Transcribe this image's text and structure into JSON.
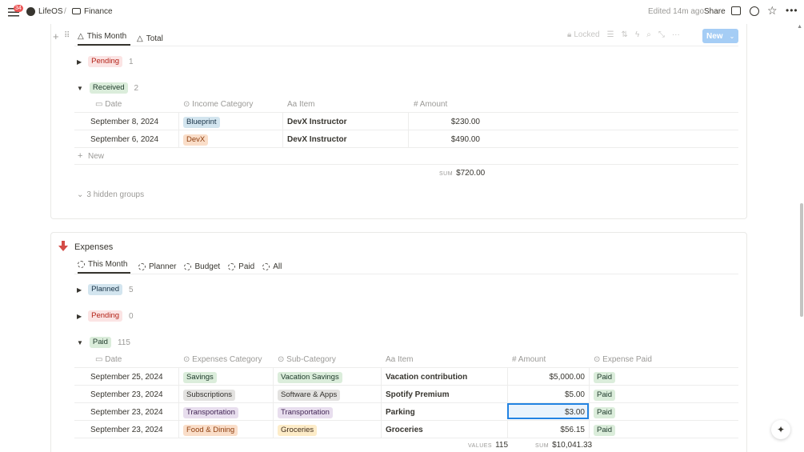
{
  "topbar": {
    "notif_count": "34",
    "crumb1": "LifeOS",
    "sep": "/",
    "crumb2": "Finance",
    "edited": "Edited 14m ago",
    "share": "Share"
  },
  "income": {
    "tabs": [
      "This Month",
      "Total"
    ],
    "toolbar": {
      "locked": "Locked",
      "new": "New"
    },
    "groups": [
      {
        "label": "Pending",
        "count": "1",
        "color": "red"
      },
      {
        "label": "Received",
        "count": "2",
        "color": "green"
      }
    ],
    "columns": [
      "Date",
      "Income Category",
      "Item",
      "Amount"
    ],
    "rows": [
      {
        "date": "September 8, 2024",
        "category": "Blueprint",
        "item": "DevX Instructor",
        "amount": "$230.00"
      },
      {
        "date": "September 6, 2024",
        "category": "DevX",
        "item": "DevX Instructor",
        "amount": "$490.00"
      }
    ],
    "new_row": "New",
    "sum_label": "SUM",
    "sum_value": "$720.00",
    "hidden_groups": "3 hidden groups"
  },
  "expenses": {
    "title": "Expenses",
    "tabs": [
      "This Month",
      "Planner",
      "Budget",
      "Paid",
      "All"
    ],
    "groups": [
      {
        "label": "Planned",
        "count": "5"
      },
      {
        "label": "Pending",
        "count": "0"
      },
      {
        "label": "Paid",
        "count": "115"
      }
    ],
    "columns": [
      "Date",
      "Expenses Category",
      "Sub-Category",
      "Item",
      "Amount",
      "Expense Paid"
    ],
    "rows": [
      {
        "date": "September 25, 2024",
        "category": "Savings",
        "sub": "Vacation Savings",
        "item": "Vacation contribution",
        "amount": "$5,000.00",
        "paid": "Paid"
      },
      {
        "date": "September 23, 2024",
        "category": "Subscriptions",
        "sub": "Software & Apps",
        "item": "Spotify Premium",
        "amount": "$5.00",
        "paid": "Paid"
      },
      {
        "date": "September 23, 2024",
        "category": "Transportation",
        "sub": "Transportation",
        "item": "Parking",
        "amount": "$3.00",
        "paid": "Paid"
      },
      {
        "date": "September 23, 2024",
        "category": "Food & Dining",
        "sub": "Groceries",
        "item": "Groceries",
        "amount": "$56.15",
        "paid": "Paid"
      }
    ],
    "values_label": "VALUES",
    "values_count": "115",
    "sum_label": "SUM",
    "sum_value": "$10,041.33"
  },
  "colors": {
    "accent": "#2383e2",
    "new_button": "#a5cdf5",
    "arrow_red": "#d44c47"
  }
}
